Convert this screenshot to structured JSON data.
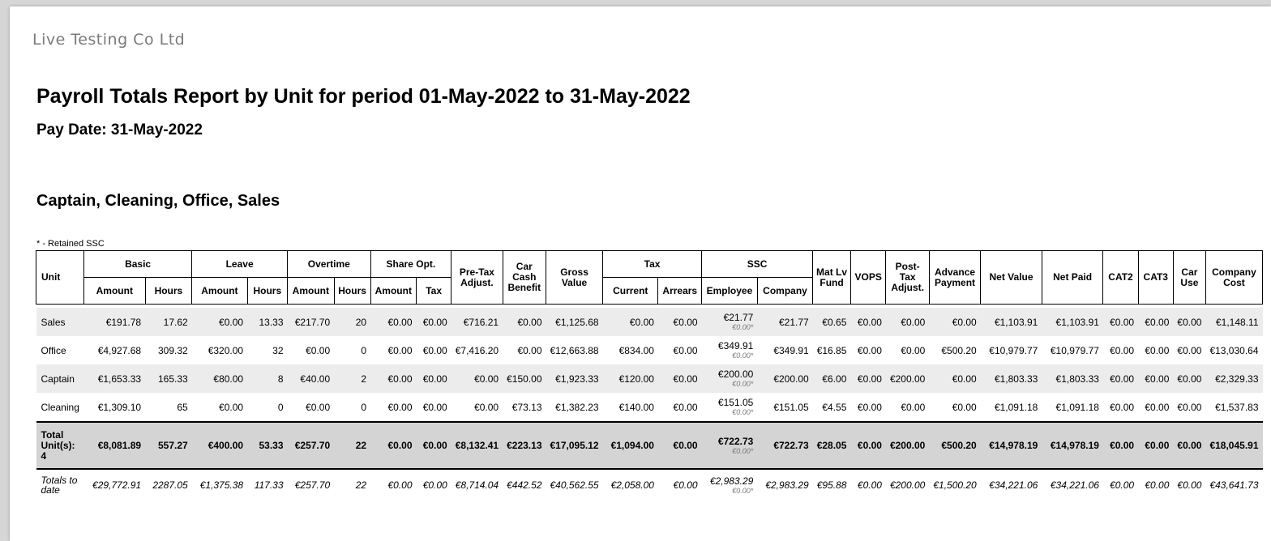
{
  "company": "Live Testing Co Ltd",
  "title": "Payroll Totals Report by Unit for period 01-May-2022 to 31-May-2022",
  "pay_date": "Pay Date: 31-May-2022",
  "units_heading": "Captain, Cleaning, Office, Sales",
  "retained_note": "* - Retained SSC",
  "headers": {
    "unit": "Unit",
    "basic": "Basic",
    "leave": "Leave",
    "overtime": "Overtime",
    "share_opt": "Share Opt.",
    "pre_tax_adjust": "Pre-Tax Adjust.",
    "car_cash_benefit": "Car Cash Benefit",
    "gross_value": "Gross Value",
    "tax": "Tax",
    "ssc": "SSC",
    "mat_lv_fund": "Mat Lv Fund",
    "vops": "VOPS",
    "post_tax_adjust": "Post-Tax Adjust.",
    "advance_payment": "Advance Payment",
    "net_value": "Net Value",
    "net_paid": "Net Paid",
    "cat2": "CAT2",
    "cat3": "CAT3",
    "car_use": "Car Use",
    "company_cost": "Company Cost",
    "amount": "Amount",
    "hours": "Hours",
    "tax_sub": "Tax",
    "current": "Current",
    "arrears": "Arrears",
    "employee": "Employee",
    "company_sub": "Company"
  },
  "rows": [
    {
      "unit": "Sales",
      "basic_amount": "€191.78",
      "basic_hours": "17.62",
      "leave_amount": "€0.00",
      "leave_hours": "13.33",
      "ot_amount": "€217.70",
      "ot_hours": "20",
      "share_amount": "€0.00",
      "share_tax": "€0.00",
      "pre_tax": "€716.21",
      "car_cash": "€0.00",
      "gross": "€1,125.68",
      "tax_current": "€0.00",
      "tax_arrears": "€0.00",
      "ssc_employee": "€21.77",
      "ssc_retained": "€0.00*",
      "ssc_company": "€21.77",
      "mat_lv": "€0.65",
      "vops": "€0.00",
      "post_tax": "€0.00",
      "advance": "€0.00",
      "net_value": "€1,103.91",
      "net_paid": "€1,103.91",
      "cat2": "€0.00",
      "cat3": "€0.00",
      "car_use": "€0.00",
      "company_cost": "€1,148.11"
    },
    {
      "unit": "Office",
      "basic_amount": "€4,927.68",
      "basic_hours": "309.32",
      "leave_amount": "€320.00",
      "leave_hours": "32",
      "ot_amount": "€0.00",
      "ot_hours": "0",
      "share_amount": "€0.00",
      "share_tax": "€0.00",
      "pre_tax": "€7,416.20",
      "car_cash": "€0.00",
      "gross": "€12,663.88",
      "tax_current": "€834.00",
      "tax_arrears": "€0.00",
      "ssc_employee": "€349.91",
      "ssc_retained": "€0.00*",
      "ssc_company": "€349.91",
      "mat_lv": "€16.85",
      "vops": "€0.00",
      "post_tax": "€0.00",
      "advance": "€500.20",
      "net_value": "€10,979.77",
      "net_paid": "€10,979.77",
      "cat2": "€0.00",
      "cat3": "€0.00",
      "car_use": "€0.00",
      "company_cost": "€13,030.64"
    },
    {
      "unit": "Captain",
      "basic_amount": "€1,653.33",
      "basic_hours": "165.33",
      "leave_amount": "€80.00",
      "leave_hours": "8",
      "ot_amount": "€40.00",
      "ot_hours": "2",
      "share_amount": "€0.00",
      "share_tax": "€0.00",
      "pre_tax": "€0.00",
      "car_cash": "€150.00",
      "gross": "€1,923.33",
      "tax_current": "€120.00",
      "tax_arrears": "€0.00",
      "ssc_employee": "€200.00",
      "ssc_retained": "€0.00*",
      "ssc_company": "€200.00",
      "mat_lv": "€6.00",
      "vops": "€0.00",
      "post_tax": "€200.00",
      "advance": "€0.00",
      "net_value": "€1,803.33",
      "net_paid": "€1,803.33",
      "cat2": "€0.00",
      "cat3": "€0.00",
      "car_use": "€0.00",
      "company_cost": "€2,329.33"
    },
    {
      "unit": "Cleaning",
      "basic_amount": "€1,309.10",
      "basic_hours": "65",
      "leave_amount": "€0.00",
      "leave_hours": "0",
      "ot_amount": "€0.00",
      "ot_hours": "0",
      "share_amount": "€0.00",
      "share_tax": "€0.00",
      "pre_tax": "€0.00",
      "car_cash": "€73.13",
      "gross": "€1,382.23",
      "tax_current": "€140.00",
      "tax_arrears": "€0.00",
      "ssc_employee": "€151.05",
      "ssc_retained": "€0.00*",
      "ssc_company": "€151.05",
      "mat_lv": "€4.55",
      "vops": "€0.00",
      "post_tax": "€0.00",
      "advance": "€0.00",
      "net_value": "€1,091.18",
      "net_paid": "€1,091.18",
      "cat2": "€0.00",
      "cat3": "€0.00",
      "car_use": "€0.00",
      "company_cost": "€1,537.83"
    }
  ],
  "total": {
    "unit": "Total Unit(s): 4",
    "basic_amount": "€8,081.89",
    "basic_hours": "557.27",
    "leave_amount": "€400.00",
    "leave_hours": "53.33",
    "ot_amount": "€257.70",
    "ot_hours": "22",
    "share_amount": "€0.00",
    "share_tax": "€0.00",
    "pre_tax": "€8,132.41",
    "car_cash": "€223.13",
    "gross": "€17,095.12",
    "tax_current": "€1,094.00",
    "tax_arrears": "€0.00",
    "ssc_employee": "€722.73",
    "ssc_retained": "€0.00*",
    "ssc_company": "€722.73",
    "mat_lv": "€28.05",
    "vops": "€0.00",
    "post_tax": "€200.00",
    "advance": "€500.20",
    "net_value": "€14,978.19",
    "net_paid": "€14,978.19",
    "cat2": "€0.00",
    "cat3": "€0.00",
    "car_use": "€0.00",
    "company_cost": "€18,045.91"
  },
  "to_date": {
    "unit": "Totals to date",
    "basic_amount": "€29,772.91",
    "basic_hours": "2287.05",
    "leave_amount": "€1,375.38",
    "leave_hours": "117.33",
    "ot_amount": "€257.70",
    "ot_hours": "22",
    "share_amount": "€0.00",
    "share_tax": "€0.00",
    "pre_tax": "€8,714.04",
    "car_cash": "€442.52",
    "gross": "€40,562.55",
    "tax_current": "€2,058.00",
    "tax_arrears": "€0.00",
    "ssc_employee": "€2,983.29",
    "ssc_retained": "€0.00*",
    "ssc_company": "€2,983.29",
    "mat_lv": "€95.88",
    "vops": "€0.00",
    "post_tax": "€200.00",
    "advance": "€1,500.20",
    "net_value": "€34,221.06",
    "net_paid": "€34,221.06",
    "cat2": "€0.00",
    "cat3": "€0.00",
    "car_use": "€0.00",
    "company_cost": "€43,641.73"
  }
}
